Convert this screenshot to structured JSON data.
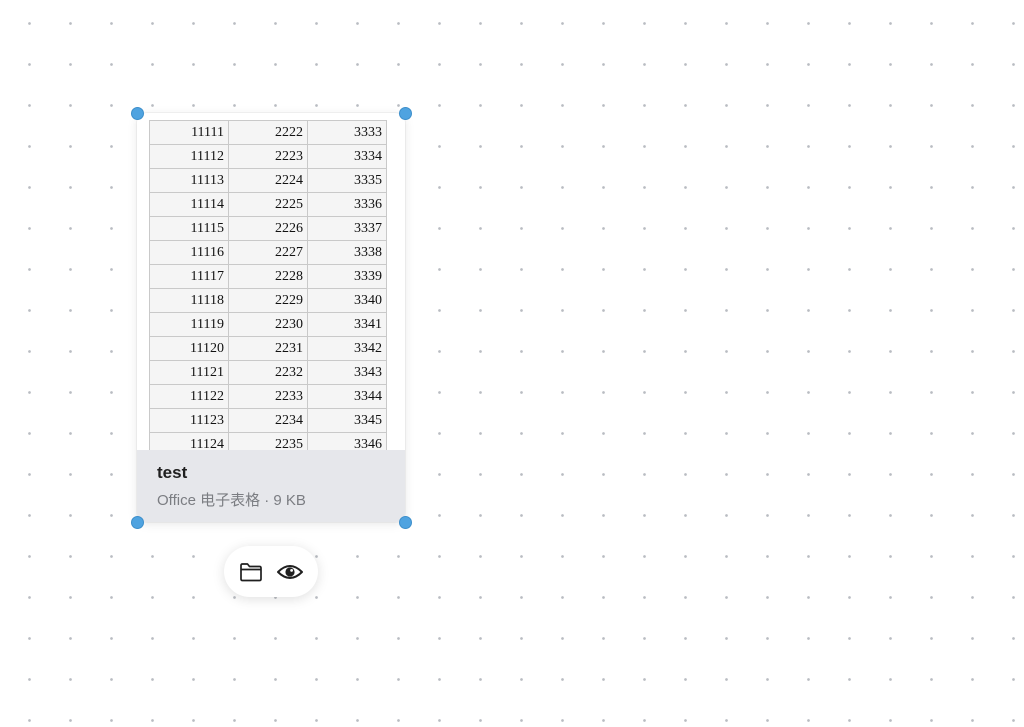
{
  "file": {
    "name": "test",
    "type_label": "Office 电子表格",
    "separator": "·",
    "size": "9 KB"
  },
  "preview": {
    "rows": [
      [
        "11111",
        "2222",
        "3333"
      ],
      [
        "11112",
        "2223",
        "3334"
      ],
      [
        "11113",
        "2224",
        "3335"
      ],
      [
        "11114",
        "2225",
        "3336"
      ],
      [
        "11115",
        "2226",
        "3337"
      ],
      [
        "11116",
        "2227",
        "3338"
      ],
      [
        "11117",
        "2228",
        "3339"
      ],
      [
        "11118",
        "2229",
        "3340"
      ],
      [
        "11119",
        "2230",
        "3341"
      ],
      [
        "11120",
        "2231",
        "3342"
      ],
      [
        "11121",
        "2232",
        "3343"
      ],
      [
        "11122",
        "2233",
        "3344"
      ],
      [
        "11123",
        "2234",
        "3345"
      ],
      [
        "11124",
        "2235",
        "3346"
      ]
    ]
  },
  "toolbar": {
    "buttons": [
      {
        "icon": "folder-icon"
      },
      {
        "icon": "eye-icon"
      }
    ]
  },
  "colors": {
    "handle": "#4fa3e0",
    "canvas_dot": "#b9bcc2",
    "info_bg": "#e6e7eb"
  }
}
